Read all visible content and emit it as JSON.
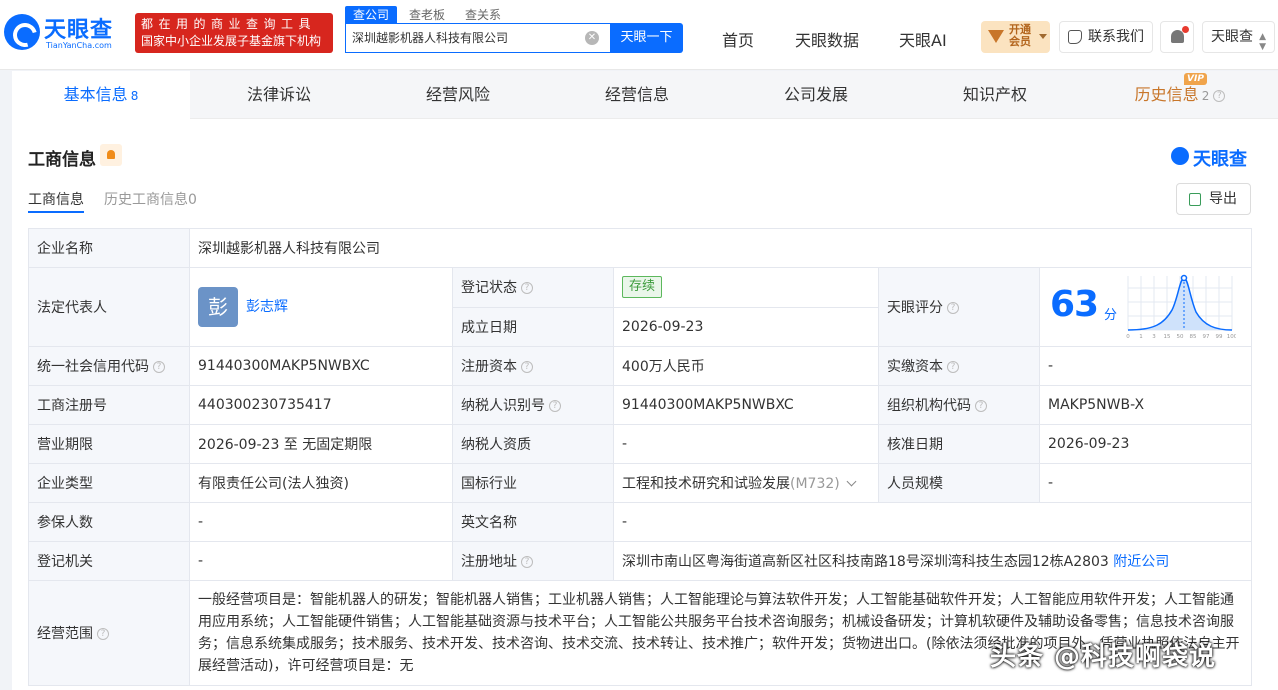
{
  "header": {
    "logo_text": "天眼查",
    "logo_sub": "TianYanCha.com",
    "slogan_line1": "都在用的商业查询工具",
    "slogan_line2": "国家中小企业发展子基金旗下机构",
    "search_tabs": [
      "查公司",
      "查老板",
      "查关系"
    ],
    "search_value": "深圳越影机器人科技有限公司",
    "search_button": "天眼一下",
    "nav": [
      "首页",
      "天眼数据",
      "天眼AI"
    ],
    "vip_line1": "开通",
    "vip_line2": "会员",
    "contact": "联系我们",
    "user": "天眼查"
  },
  "tabs": [
    {
      "label": "基本信息",
      "count": "8"
    },
    {
      "label": "法律诉讼"
    },
    {
      "label": "经营风险"
    },
    {
      "label": "经营信息"
    },
    {
      "label": "公司发展"
    },
    {
      "label": "知识产权"
    },
    {
      "label": "历史信息",
      "count": "2",
      "badge": "VIP"
    }
  ],
  "section": {
    "title": "工商信息",
    "brand": "天眼查",
    "subtabs": [
      "工商信息",
      "历史工商信息0"
    ],
    "export": "导出"
  },
  "info": {
    "company_name_label": "企业名称",
    "company_name": "深圳越影机器人科技有限公司",
    "legal_rep_label": "法定代表人",
    "legal_rep_avatar": "彭",
    "legal_rep": "彭志辉",
    "reg_status_label": "登记状态",
    "reg_status": "存续",
    "found_date_label": "成立日期",
    "found_date": "2026-09-23",
    "score_label": "天眼评分",
    "score": "63",
    "score_unit": "分",
    "score_axis": [
      "0",
      "1",
      "3",
      "15",
      "50",
      "85",
      "97",
      "99",
      "100"
    ],
    "credit_code_label": "统一社会信用代码",
    "credit_code": "91440300MAKP5NWBXC",
    "reg_capital_label": "注册资本",
    "reg_capital": "400万人民币",
    "paid_capital_label": "实缴资本",
    "paid_capital": "-",
    "reg_no_label": "工商注册号",
    "reg_no": "440300230735417",
    "taxpayer_id_label": "纳税人识别号",
    "taxpayer_id": "91440300MAKP5NWBXC",
    "org_code_label": "组织机构代码",
    "org_code": "MAKP5NWB-X",
    "term_label": "营业期限",
    "term": "2026-09-23 至 无固定期限",
    "taxpayer_qual_label": "纳税人资质",
    "taxpayer_qual": "-",
    "approve_date_label": "核准日期",
    "approve_date": "2026-09-23",
    "type_label": "企业类型",
    "type": "有限责任公司(法人独资)",
    "industry_label": "国标行业",
    "industry": "工程和技术研究和试验发展",
    "industry_code": "(M732)",
    "staff_label": "人员规模",
    "staff": "-",
    "insured_label": "参保人数",
    "insured": "-",
    "english_name_label": "英文名称",
    "english_name": "-",
    "authority_label": "登记机关",
    "authority": "-",
    "address_label": "注册地址",
    "address": "深圳市南山区粤海街道高新区社区科技南路18号深圳湾科技生态园12栋A2803",
    "nearby": "附近公司",
    "scope_label": "经营范围",
    "scope": "一般经营项目是：智能机器人的研发；智能机器人销售；工业机器人销售；人工智能理论与算法软件开发；人工智能基础软件开发；人工智能应用软件开发；人工智能通用应用系统；人工智能硬件销售；人工智能基础资源与技术平台；人工智能公共服务平台技术咨询服务；机械设备研发；计算机软硬件及辅助设备零售；信息技术咨询服务；信息系统集成服务；技术服务、技术开发、技术咨询、技术交流、技术转让、技术推广；软件开发；货物进出口。(除依法须经批准的项目外，凭营业执照依法自主开展经营活动)，许可经营项目是：无"
  },
  "watermark": "头条 @科技啊袋说",
  "colors": {
    "brand": "#0a6cff",
    "slogan_bg": "#d7261e",
    "vip_gold": "#c8762a",
    "status_green": "#3c9c3c"
  }
}
